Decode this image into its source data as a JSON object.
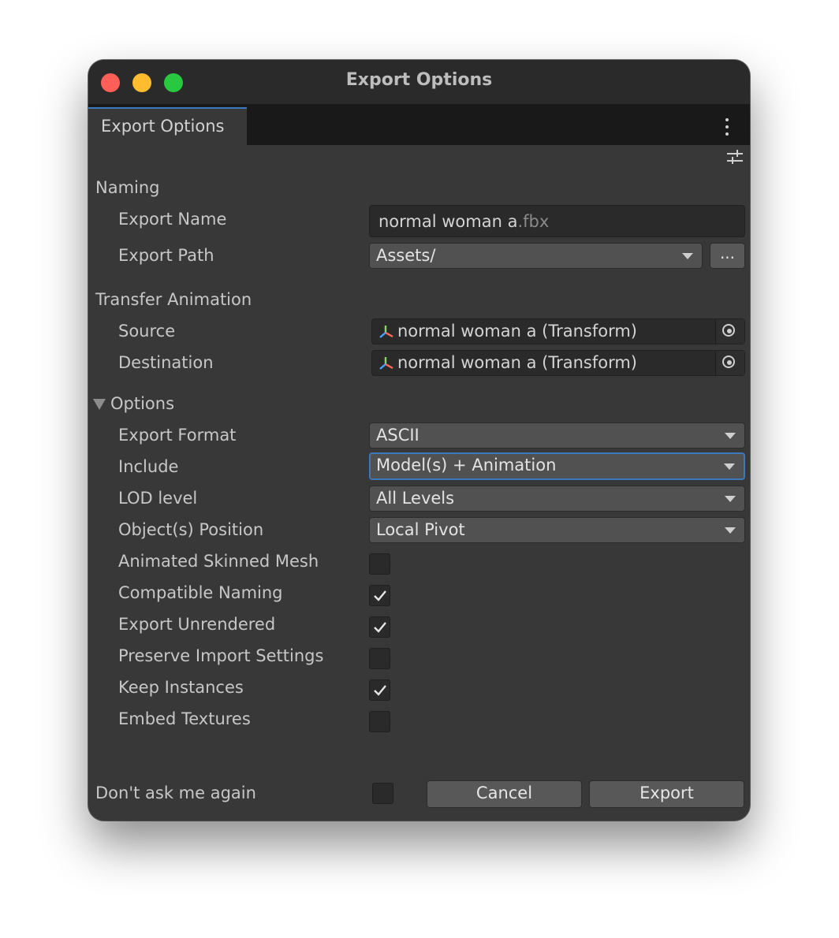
{
  "window": {
    "title": "Export Options",
    "controls": [
      "close",
      "minimize",
      "zoom"
    ]
  },
  "tab": {
    "label": "Export Options",
    "menu_icon": "kebab-menu-icon",
    "settings_icon": "sliders-icon"
  },
  "naming": {
    "section_label": "Naming",
    "export_name_label": "Export Name",
    "export_name_value": "normal woman a",
    "export_name_ext": ".fbx",
    "export_path_label": "Export Path",
    "export_path_value": "Assets/",
    "browse_label": "..."
  },
  "transfer": {
    "section_label": "Transfer Animation",
    "source_label": "Source",
    "source_value": "normal woman a (Transform)",
    "destination_label": "Destination",
    "destination_value": "normal woman a (Transform)"
  },
  "options": {
    "section_label": "Options",
    "expanded": true,
    "export_format_label": "Export Format",
    "export_format_value": "ASCII",
    "include_label": "Include",
    "include_value": "Model(s) + Animation",
    "lod_label": "LOD level",
    "lod_value": "All Levels",
    "position_label": "Object(s) Position",
    "position_value": "Local Pivot",
    "checkboxes": [
      {
        "label": "Animated Skinned Mesh",
        "checked": false
      },
      {
        "label": "Compatible Naming",
        "checked": true
      },
      {
        "label": "Export Unrendered",
        "checked": true
      },
      {
        "label": "Preserve Import Settings",
        "checked": false
      },
      {
        "label": "Keep Instances",
        "checked": true
      },
      {
        "label": "Embed Textures",
        "checked": false
      }
    ]
  },
  "footer": {
    "dont_ask_label": "Don't ask me again",
    "dont_ask_checked": false,
    "cancel_label": "Cancel",
    "export_label": "Export"
  },
  "colors": {
    "background": "#383838",
    "titlebar": "#2a2a2a",
    "tabbar": "#191919",
    "accent": "#3a79bb"
  }
}
